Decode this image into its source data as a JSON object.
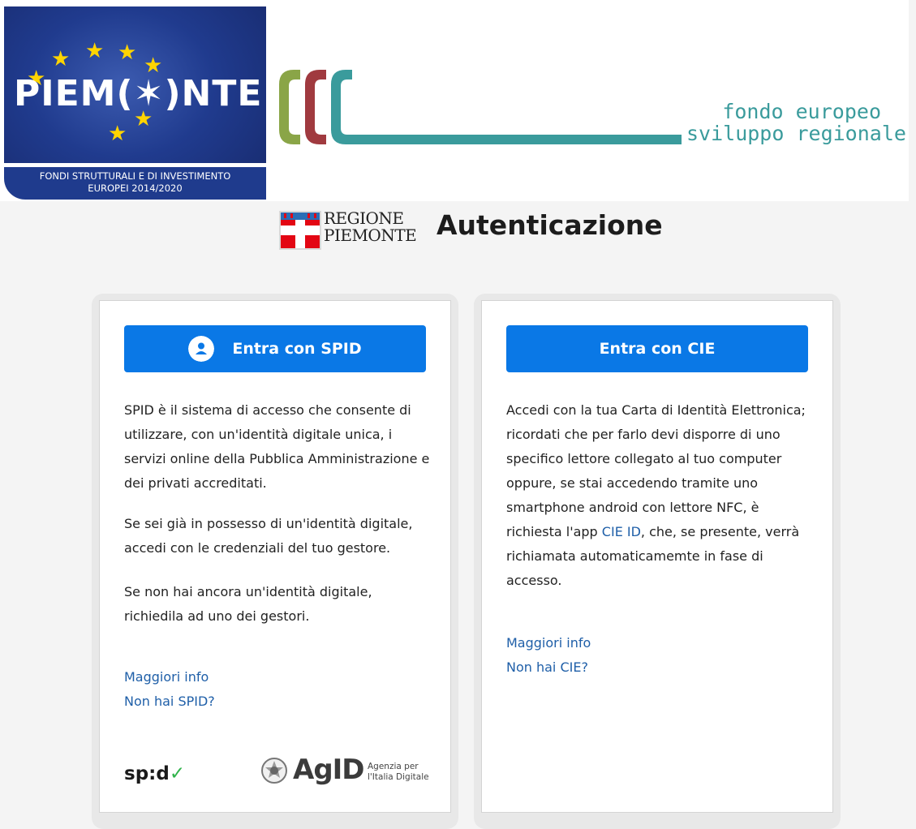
{
  "banner": {
    "piemonte_wordmark": "PIEM(✶)NTE",
    "piemonte_subtitle_line1": "FONDI STRUTTURALI E DI INVESTIMENTO",
    "piemonte_subtitle_line2": "EUROPEI 2014/2020",
    "fesr_line1": "fondo europeo",
    "fesr_line2": "sviluppo regionale",
    "colors": {
      "piemonte_blue": "#1f3b8d",
      "star_yellow": "#ffd400",
      "fesr_teal": "#3a9b9c",
      "fesr_green": "#8aa547",
      "fesr_red": "#a03a3f"
    }
  },
  "header": {
    "regione_line1": "REGIONE",
    "regione_line2": "PIEMONTE",
    "title": "Autenticazione"
  },
  "spid_card": {
    "button_label": "Entra con SPID",
    "paragraph1": "SPID è il sistema di accesso che consente di utilizzare, con un'identità digitale unica, i servizi online della Pubblica Amministrazione e dei privati accreditati.",
    "paragraph2": "Se sei già in possesso di un'identità digitale, accedi con le credenziali del tuo gestore.",
    "paragraph3": "Se non hai ancora un'identità digitale, richiedila ad uno dei gestori.",
    "link_more": "Maggiori info",
    "link_no_account": "Non hai SPID?",
    "footer_spid_logo": "sp:d",
    "footer_agid_word": "AgID",
    "footer_agid_sub1": "Agenzia per",
    "footer_agid_sub2": "l'Italia Digitale"
  },
  "cie_card": {
    "button_label": "Entra con CIE",
    "paragraph_before_link": "Accedi con la tua Carta di Identità Elettronica; ricordati che per farlo devi disporre di uno specifico lettore collegato al tuo computer oppure, se stai accedendo tramite uno smartphone android con lettore NFC, è richiesta l'app ",
    "paragraph_link": "CIE ID",
    "paragraph_after_link": ", che, se presente, verrà richiamata automaticamemte in fase di accesso.",
    "link_more": "Maggiori info",
    "link_no_account": "Non hai CIE?"
  },
  "colors": {
    "primary_button": "#0a78e6",
    "link": "#1f5fa8",
    "page_bg": "#f4f4f4"
  }
}
